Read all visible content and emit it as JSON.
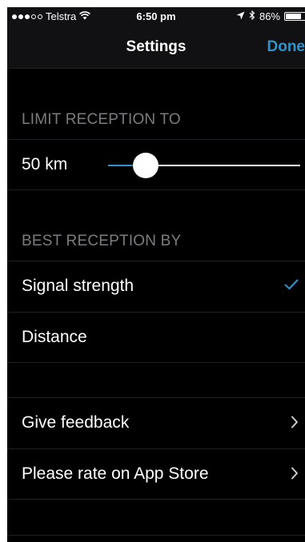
{
  "status_bar": {
    "carrier": "Telstra",
    "time": "6:50 pm",
    "battery": "86%",
    "battery_level": 0.86,
    "signal_bars_filled": 3,
    "signal_bars_total": 5,
    "icons": [
      "signal-dots-icon",
      "wifi-icon",
      "location-arrow-icon",
      "bluetooth-icon",
      "battery-icon"
    ]
  },
  "nav": {
    "title": "Settings",
    "done_label": "Done"
  },
  "limit_section": {
    "header": "LIMIT RECEPTION TO",
    "value_label": "50 km",
    "slider_fraction": 0.19
  },
  "best_section": {
    "header": "BEST RECEPTION BY",
    "options": [
      {
        "label": "Signal strength",
        "selected": true
      },
      {
        "label": "Distance",
        "selected": false
      }
    ]
  },
  "links": [
    {
      "label": "Give feedback"
    },
    {
      "label": "Please rate on App Store"
    }
  ],
  "colors": {
    "accent": "#2f94cc",
    "background": "#000000",
    "bar_background": "#111113",
    "section_header": "#7b7b80",
    "separator": "#1f1f24"
  }
}
